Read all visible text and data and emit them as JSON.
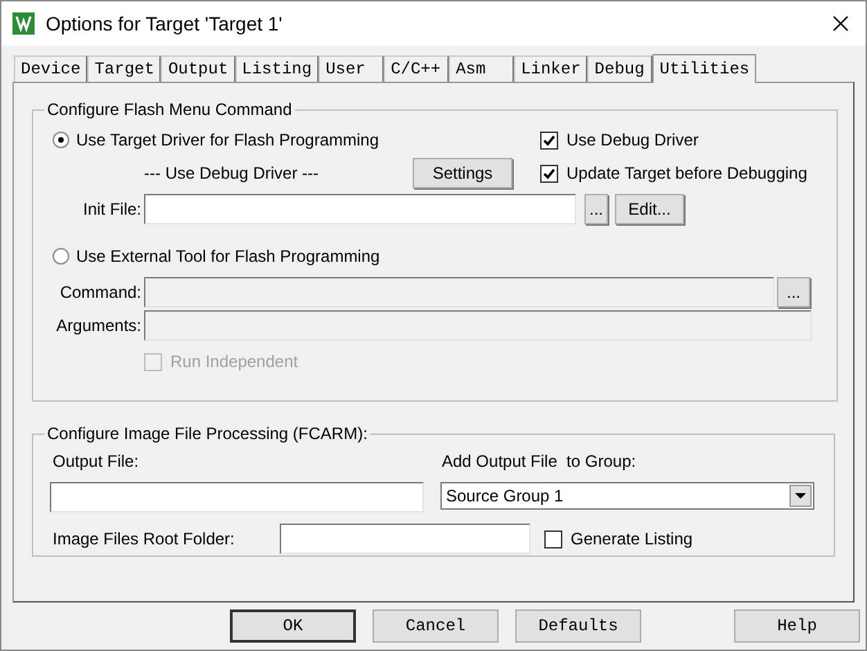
{
  "window": {
    "title": "Options for Target 'Target 1'"
  },
  "tabs": [
    {
      "label": "Device",
      "selected": false
    },
    {
      "label": "Target",
      "selected": false
    },
    {
      "label": "Output",
      "selected": false
    },
    {
      "label": "Listing",
      "selected": false
    },
    {
      "label": "User",
      "selected": false
    },
    {
      "label": "C/C++",
      "selected": false
    },
    {
      "label": "Asm",
      "selected": false
    },
    {
      "label": "Linker",
      "selected": false
    },
    {
      "label": "Debug",
      "selected": false
    },
    {
      "label": "Utilities",
      "selected": true
    }
  ],
  "flash_group": {
    "title": "Configure Flash Menu Command",
    "target_driver": {
      "label": "Use Target Driver for Flash Programming",
      "selected": true
    },
    "driver_name": "--- Use Debug Driver ---",
    "settings_button": "Settings",
    "use_debug_driver": {
      "label": "Use Debug Driver",
      "checked": true
    },
    "update_target": {
      "label": "Update Target before Debugging",
      "checked": true
    },
    "init_file": {
      "label": "Init File:",
      "browse": "...",
      "edit": "Edit..."
    },
    "external_tool": {
      "label": "Use External Tool for Flash Programming",
      "selected": false
    },
    "command": {
      "label": "Command:",
      "browse": "...",
      "disabled": true
    },
    "arguments": {
      "label": "Arguments:",
      "disabled": true
    },
    "run_independent": {
      "label": "Run Independent",
      "checked": false,
      "disabled": true
    }
  },
  "image_group": {
    "title": "Configure Image File Processing (FCARM):",
    "output_file": {
      "label": "Output File:"
    },
    "add_to_group": {
      "label": "Add Output File  to Group:",
      "value": "Source Group 1"
    },
    "root_folder": {
      "label": "Image Files Root Folder:"
    },
    "generate_listing": {
      "label": "Generate Listing",
      "checked": false
    }
  },
  "buttons": [
    "OK",
    "Cancel",
    "Defaults",
    "Help"
  ]
}
